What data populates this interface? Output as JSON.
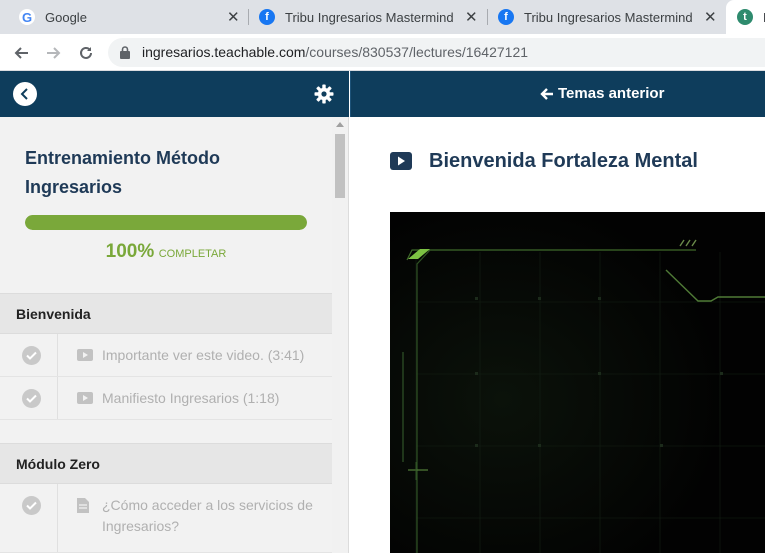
{
  "browser": {
    "tabs": [
      {
        "title": "Google",
        "icon": "google-icon"
      },
      {
        "title": "Tribu Ingresarios Mastermind | Fa",
        "icon": "facebook-icon"
      },
      {
        "title": "Tribu Ingresarios Mastermind | Fa",
        "icon": "facebook-icon"
      },
      {
        "title": "E",
        "icon": "teachable-icon"
      }
    ],
    "url_host": "ingresarios.teachable.com",
    "url_path": "/courses/830537/lectures/16427121"
  },
  "header": {
    "prev_label": "Temas anterior"
  },
  "course": {
    "title": "Entrenamiento Método Ingresarios",
    "progress_value": "100%",
    "progress_label": "COMPLETAR",
    "progress_fraction": 1.0,
    "accent_color": "#7aa83a",
    "header_color": "#0e3d5c"
  },
  "sections": [
    {
      "title": "Bienvenida",
      "lessons": [
        {
          "name": "Importante ver este video. (3:41)",
          "type": "video-icon",
          "completed": true
        },
        {
          "name": "Manifiesto Ingresarios (1:18)",
          "type": "video-icon",
          "completed": true
        }
      ]
    },
    {
      "title": "Módulo Zero",
      "lessons": [
        {
          "name": "¿Cómo acceder a los servicios de Ingresarios?",
          "type": "document-icon",
          "completed": true
        }
      ]
    }
  ],
  "lecture": {
    "title": "Bienvenida Fortaleza Mental"
  }
}
